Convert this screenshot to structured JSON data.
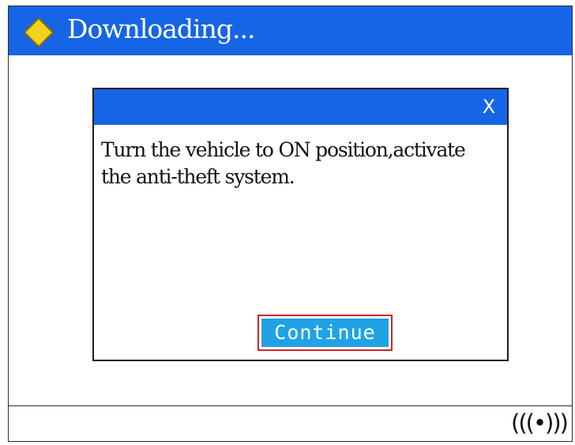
{
  "header": {
    "title": "Downloading...",
    "icon": "diamond-icon",
    "accent_color": "#1565e6"
  },
  "dialog": {
    "close_label": "X",
    "message_line1": "Turn the vehicle to ON position,activate",
    "message_line2": "the anti-theft system.",
    "continue_label": "Continue",
    "continue_color": "#1fa3e6",
    "focus_color": "#d32525"
  },
  "status_bar": {
    "signal_icon": "wireless-signal-icon",
    "signal_glyph": "(((•)))"
  }
}
